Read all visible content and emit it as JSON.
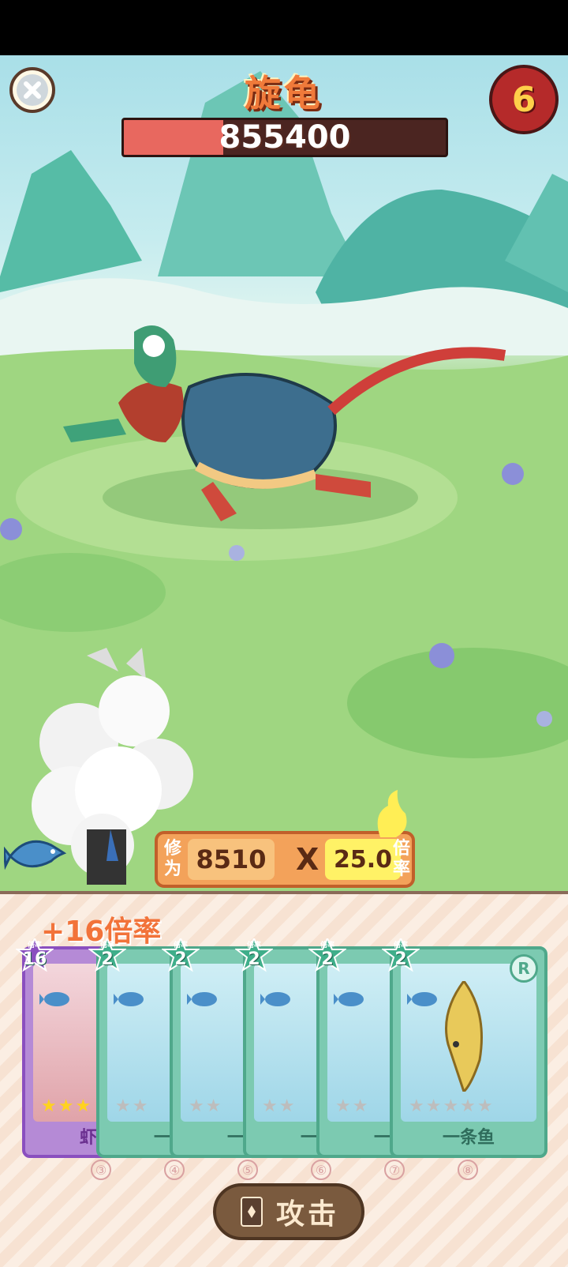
{
  "boss": {
    "name": "旋龟",
    "hp": "855400",
    "hp_fill_fraction": 0.31
  },
  "turns_left": "6",
  "score": {
    "cultivation_label": [
      "修",
      "为"
    ],
    "cultivation_value": "8510",
    "times_sign": "X",
    "multiplier_value": "25.0",
    "multiplier_label": [
      "倍",
      "率"
    ]
  },
  "bonus_text": "+16倍率",
  "rate_label": "倍率",
  "cards": [
    {
      "rate": "16",
      "name": "虾兵",
      "rarity": "purple",
      "stars": 3
    },
    {
      "rate": "2",
      "name": "一条",
      "rarity": "green",
      "stars": 0
    },
    {
      "rate": "2",
      "name": "一条",
      "rarity": "green",
      "stars": 0
    },
    {
      "rate": "2",
      "name": "一条",
      "rarity": "green",
      "stars": 0
    },
    {
      "rate": "2",
      "name": "一条",
      "rarity": "green",
      "stars": 0
    },
    {
      "rate": "2",
      "name": "一条鱼",
      "rarity": "green",
      "stars": 0,
      "badge": "R"
    }
  ],
  "slot_numbers": [
    "③",
    "④",
    "⑤",
    "⑥",
    "⑦",
    "⑧"
  ],
  "attack_label": "攻击",
  "colors": {
    "accent": "#f07a3a",
    "hp": "#e8685f",
    "card_green": "#7ccab1",
    "card_purple": "#b58ad6"
  }
}
